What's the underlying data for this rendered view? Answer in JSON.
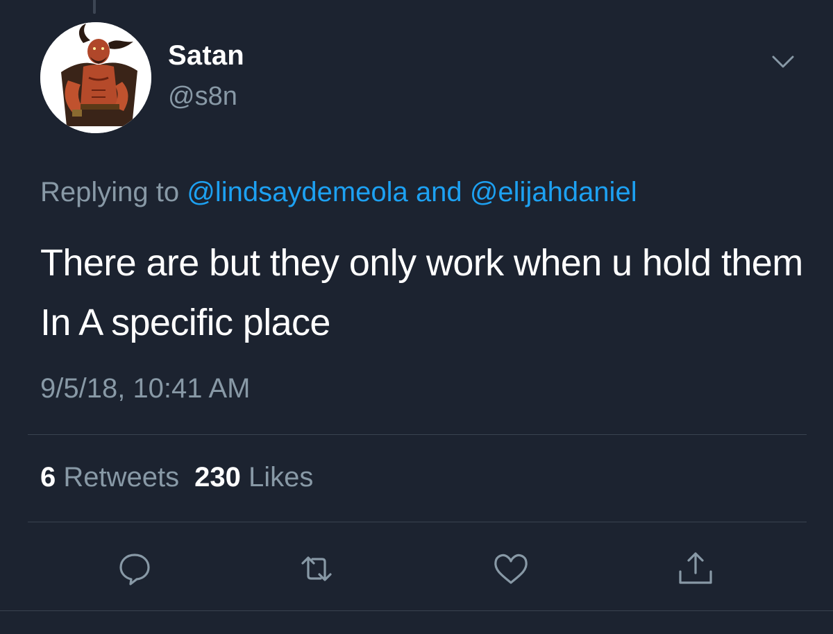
{
  "tweet": {
    "display_name": "Satan",
    "handle": "@s8n",
    "replying_prefix": "Replying to",
    "replying_mention_1": "@lindsaydemeola",
    "replying_conjunction": "and",
    "replying_mention_2": "@elijahdaniel",
    "text": "There are but they only work when u hold them In A specific place",
    "timestamp": "9/5/18, 10:41 AM"
  },
  "stats": {
    "retweets_count": "6",
    "retweets_label": "Retweets",
    "likes_count": "230",
    "likes_label": "Likes"
  },
  "icons": {
    "caret": "chevron-down-icon",
    "reply": "reply-icon",
    "retweet": "retweet-icon",
    "like": "heart-icon",
    "share": "share-icon"
  },
  "colors": {
    "background": "#1c2330",
    "secondary_text": "#8899a6",
    "mention": "#1da1f2",
    "divider": "#3a4350"
  }
}
